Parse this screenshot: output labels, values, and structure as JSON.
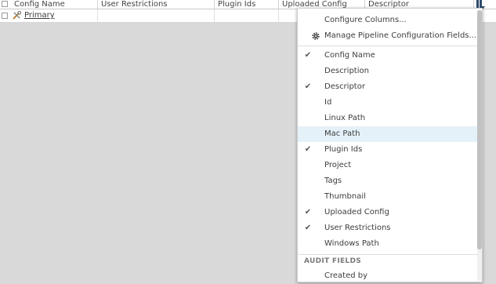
{
  "grid": {
    "columns": [
      {
        "label": "Config Name"
      },
      {
        "label": "User Restrictions"
      },
      {
        "label": "Plugin Ids"
      },
      {
        "label": "Uploaded Config"
      },
      {
        "label": "Descriptor"
      }
    ],
    "rows": [
      {
        "config_name": "Primary"
      }
    ]
  },
  "menu": {
    "top_items": [
      {
        "label": "Configure Columns..."
      },
      {
        "label": "Manage Pipeline Configuration Fields..."
      }
    ],
    "fields": [
      {
        "label": "Config Name",
        "checked": true
      },
      {
        "label": "Description",
        "checked": false
      },
      {
        "label": "Descriptor",
        "checked": true
      },
      {
        "label": "Id",
        "checked": false
      },
      {
        "label": "Linux Path",
        "checked": false
      },
      {
        "label": "Mac Path",
        "checked": false,
        "highlighted": true
      },
      {
        "label": "Plugin Ids",
        "checked": true
      },
      {
        "label": "Project",
        "checked": false
      },
      {
        "label": "Tags",
        "checked": false
      },
      {
        "label": "Thumbnail",
        "checked": false
      },
      {
        "label": "Uploaded Config",
        "checked": true
      },
      {
        "label": "User Restrictions",
        "checked": true
      },
      {
        "label": "Windows Path",
        "checked": false
      }
    ],
    "audit_section_label": "AUDIT FIELDS",
    "audit_items": [
      {
        "label": "Created by"
      }
    ],
    "check_glyph": "✔"
  },
  "colors": {
    "hover_bg": "#e5f1f8",
    "header_text": "#444444",
    "menu_text": "#3d3d3d"
  }
}
